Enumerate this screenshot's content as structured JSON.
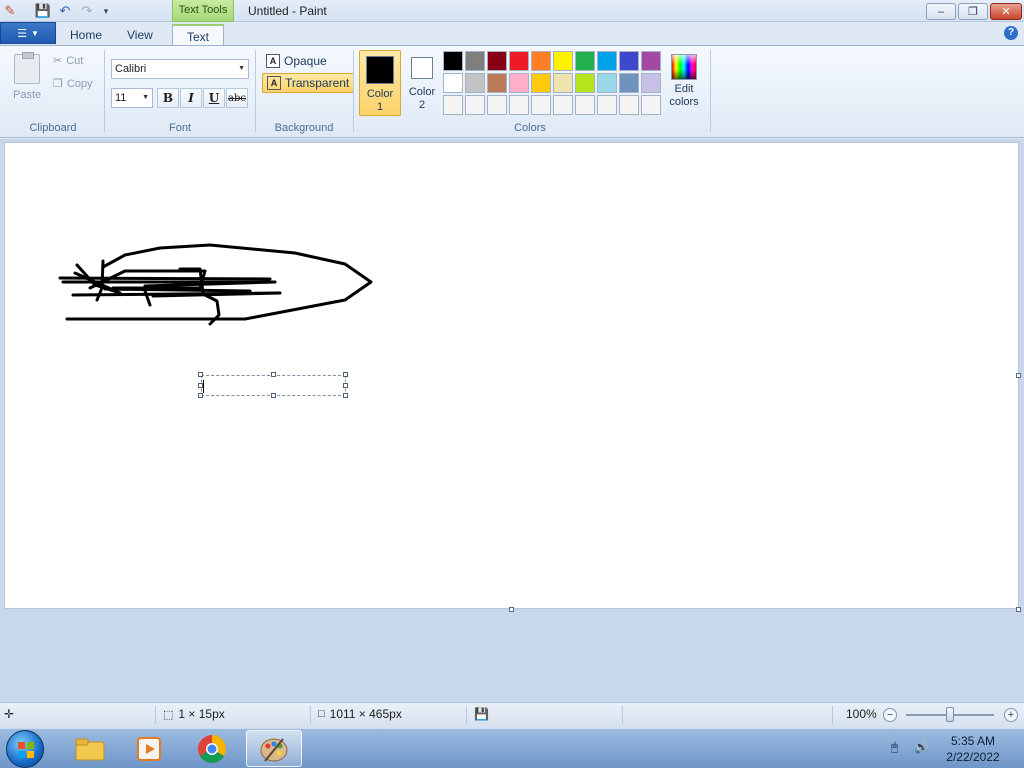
{
  "window": {
    "title": "Untitled - Paint",
    "context_tab": "Text Tools"
  },
  "tabs": [
    {
      "label": "Home",
      "active": false
    },
    {
      "label": "View",
      "active": false
    },
    {
      "label": "Text",
      "active": true
    }
  ],
  "clipboard": {
    "paste_label": "Paste",
    "cut_label": "Cut",
    "copy_label": "Copy",
    "group_label": "Clipboard"
  },
  "font": {
    "family": "Calibri",
    "size": "11",
    "bold_label": "B",
    "italic_label": "I",
    "underline_label": "U",
    "strike_label": "abc",
    "group_label": "Font"
  },
  "background": {
    "opaque_label": "Opaque",
    "transparent_label": "Transparent",
    "selected": "Transparent",
    "icon_glyph": "A",
    "group_label": "Background"
  },
  "colors": {
    "color1_label_line1": "Color",
    "color1_label_line2": "1",
    "color1_value": "#000000",
    "color2_label_line1": "Color",
    "color2_label_line2": "2",
    "color2_value": "#ffffff",
    "edit_label_line1": "Edit",
    "edit_label_line2": "colors",
    "group_label": "Colors",
    "palette": [
      "#000000",
      "#7f7f7f",
      "#880015",
      "#ed1c24",
      "#ff7f27",
      "#fff200",
      "#22b14c",
      "#00a2e8",
      "#3f48cc",
      "#a349a4",
      "#ffffff",
      "#c3c3c3",
      "#b97a57",
      "#ffaec9",
      "#ffc90e",
      "#efe4b0",
      "#b5e61d",
      "#99d9ea",
      "#7092be",
      "#c8bfe7",
      "#f5f5f5",
      "#f5f5f5",
      "#f5f5f5",
      "#f5f5f5",
      "#f5f5f5",
      "#f5f5f5",
      "#f5f5f5",
      "#f5f5f5",
      "#f5f5f5",
      "#f5f5f5"
    ]
  },
  "status": {
    "selection_size": "1 × 15px",
    "canvas_size": "1011 × 465px",
    "zoom": "100%",
    "zoom_level_pct": 50
  },
  "taskbar": {
    "time": "5:35 AM",
    "date": "2/22/2022"
  }
}
